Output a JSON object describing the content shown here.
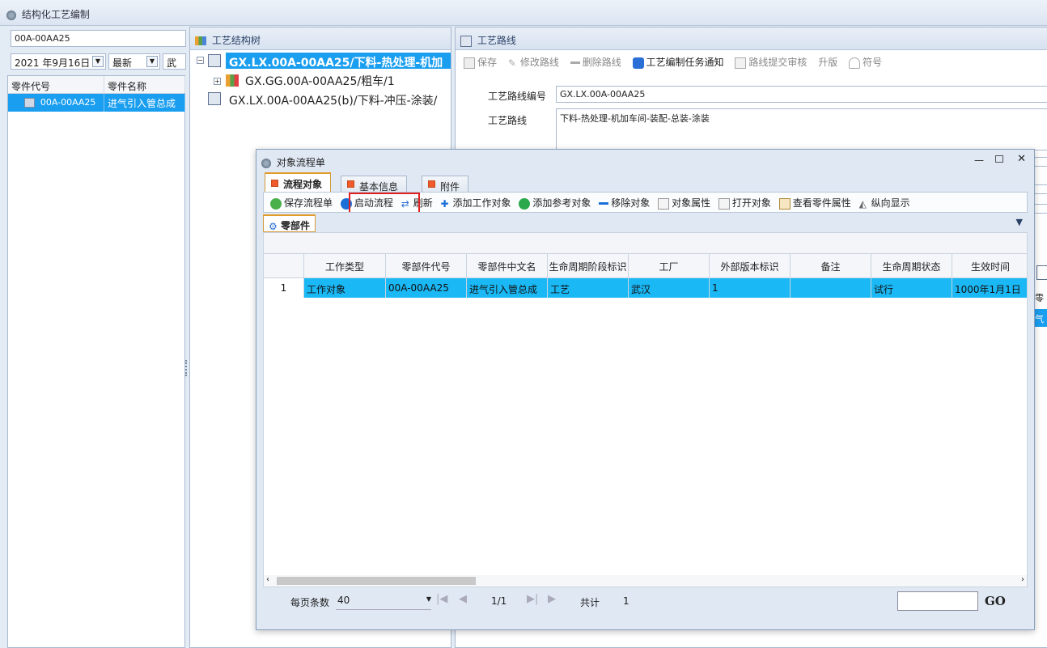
{
  "app": {
    "title": "结构化工艺编制"
  },
  "left": {
    "search_value": "00A-00AA25",
    "date_value": "2021 年9月16日",
    "version_value": "最新",
    "factory_value": "武汉",
    "columns": [
      "零件代号",
      "零件名称"
    ],
    "rows": [
      {
        "code": "00A-00AA25",
        "name": "进气引入管总成"
      }
    ]
  },
  "tree": {
    "title": "工艺结构树",
    "nodes": [
      {
        "label": "GX.LX.00A-00AA25/下料-热处理-机加"
      },
      {
        "label": "GX.GG.00A-00AA25/粗车/1"
      },
      {
        "label": "GX.LX.00A-00AA25(b)/下料-冲压-涂装/"
      }
    ]
  },
  "route": {
    "title": "工艺路线",
    "toolbar": [
      "保存",
      "修改路线",
      "删除路线",
      "工艺编制任务通知",
      "路线提交审核",
      "升版",
      "符号"
    ],
    "code_label": "工艺路线编号",
    "code_value": "GX.LX.00A-00AA25",
    "route_label": "工艺路线",
    "route_value": "下料-热处理-机加车间-装配-总装-涂装"
  },
  "modal": {
    "title": "对象流程单",
    "tabs": [
      "流程对象",
      "基本信息",
      "附件"
    ],
    "toolbar": [
      "保存流程单",
      "启动流程",
      "刷新",
      "添加工作对象",
      "添加参考对象",
      "移除对象",
      "对象属性",
      "打开对象",
      "查看零件属性",
      "纵向显示"
    ],
    "subtab": "零部件",
    "columns": [
      "工作类型",
      "零部件代号",
      "零部件中文名",
      "生命周期阶段标识",
      "工厂",
      "外部版本标识",
      "备注",
      "生命周期状态",
      "生效时间"
    ],
    "rows": [
      {
        "idx": "1",
        "cells": [
          "工作对象",
          "00A-00AA25",
          "进气引入管总成",
          "工艺",
          "武汉",
          "1",
          "",
          "试行",
          "1000年1月1日"
        ]
      }
    ],
    "pager": {
      "per_page_label": "每页条数",
      "per_page_value": "40",
      "page_info": "1/1",
      "total_label": "共计",
      "total_value": "1",
      "go_label": "GO"
    },
    "right_clip": [
      "零",
      "气"
    ]
  },
  "colors": {
    "accent": "#1a9ef0",
    "highlight_box": "#e02020",
    "tab_orange": "#ef5b2b"
  }
}
